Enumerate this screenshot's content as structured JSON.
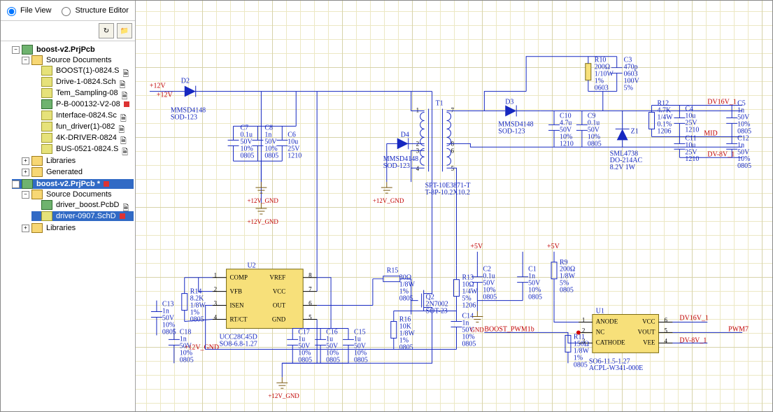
{
  "panel": {
    "view_file": "File View",
    "view_struct": "Structure Editor",
    "btn_refresh": "↻",
    "btn_locate": "📁"
  },
  "tree": {
    "p1": {
      "name": "boost-v2.PrjPcb",
      "src": "Source Documents",
      "f1": "BOOST(1)-0824.S",
      "f2": "Drive-1-0824.Sch",
      "f3": "Tem_Sampling-08",
      "f4": "P-B-000132-V2-08",
      "f5": "Interface-0824.Sc",
      "f6": "fun_driver(1)-082",
      "f7": "4K-DRIVER-0824",
      "f8": "BUS-0521-0824.S",
      "lib": "Libraries",
      "gen": "Generated"
    },
    "p2": {
      "name": "boost-v2.PrjPcb *",
      "src": "Source Documents",
      "f1": "driver_boost.PcbD",
      "f2": "driver-0907.SchD",
      "lib": "Libraries"
    }
  },
  "nets": {
    "p12v": "+12V",
    "p5v": "+5V",
    "gnd12": "+12V_GND",
    "gnd": "GND",
    "dv16": "DV16V_1",
    "dv8": "DV-8V_1",
    "mid": "MID",
    "pwm7": "PWM7",
    "boost_pwm": "BOOST_PWM1b"
  },
  "u2": {
    "ref": "U2",
    "part": "UCC28C45D",
    "pkg": "SO8-6.8-1.27",
    "p1": "COMP",
    "p2": "VFB",
    "p3": "ISEN",
    "p4": "RT/CT",
    "p5": "GND",
    "p6": "OUT",
    "p7": "VCC",
    "p8": "VREF",
    "n1": "1",
    "n2": "2",
    "n3": "3",
    "n4": "4",
    "n5": "5",
    "n6": "6",
    "n7": "7",
    "n8": "8"
  },
  "u1": {
    "ref": "U1",
    "part": "ACPL-W341-000E",
    "pkg": "SO6-11.5-1.27",
    "p1": "ANODE",
    "p2": "NC",
    "p3": "CATHODE",
    "p4": "VEE",
    "p5": "VOUT",
    "p6": "VCC",
    "n1": "1",
    "n2": "2",
    "n3": "3",
    "n4": "4",
    "n5": "5",
    "n6": "6"
  },
  "t1": {
    "ref": "T1",
    "part": "SPT-10E3871-T",
    "pkg": "T-8P-10.2X10.2",
    "p1": "1",
    "p2": "2",
    "p3": "3",
    "p4": "4",
    "p5": "5",
    "p6": "6",
    "p7": "7",
    "p8": "8"
  },
  "d2": {
    "ref": "D2",
    "part": "MMSD4148",
    "pkg": "SOD-123"
  },
  "d3": {
    "ref": "D3",
    "part": "MMSD4148",
    "pkg": "SOD-123"
  },
  "d4": {
    "ref": "D4",
    "part": "MMSD4148",
    "pkg": "SOD-123"
  },
  "z1": {
    "ref": "Z1",
    "part": "SML4738",
    "pkg": "DO-214AC",
    "val": "8.2V 1W"
  },
  "q2": {
    "ref": "Q2",
    "part": "2N7002",
    "pkg": "SOT-23"
  },
  "r9": {
    "ref": "R9",
    "val": "200Ω",
    "pwr": "1/8W",
    "tol": "5%",
    "pkg": "0805"
  },
  "r10": {
    "ref": "R10",
    "val": "200Ω",
    "pwr": "1/10W",
    "tol": "1%",
    "pkg": "0603"
  },
  "r11": {
    "ref": "R11",
    "val": "150Ω",
    "pwr": "1/8W",
    "tol": "1%",
    "pkg": "0805"
  },
  "r12": {
    "ref": "R12",
    "val": "4.7K",
    "pwr": "1/4W",
    "tol": "0.1%",
    "pkg": "1206"
  },
  "r13": {
    "ref": "R13",
    "val": "10Ω",
    "pwr": "1/4W",
    "tol": "5%",
    "pkg": "1206"
  },
  "r14": {
    "ref": "R14",
    "val": "8.2K",
    "pwr": "1/8W",
    "tol": "1%",
    "pkg": "0805"
  },
  "r15": {
    "ref": "R15",
    "val": "30Ω",
    "pwr": "1/8W",
    "tol": "1%",
    "pkg": "0805"
  },
  "r16": {
    "ref": "R16",
    "val": "10K",
    "pwr": "1/8W",
    "tol": "1%",
    "pkg": "0805"
  },
  "c1": {
    "ref": "C1",
    "val": "1n",
    "volt": "50V",
    "tol": "10%",
    "pkg": "0805"
  },
  "c2": {
    "ref": "C2",
    "val": "0.1u",
    "volt": "50V",
    "tol": "10%",
    "pkg": "0805"
  },
  "c3": {
    "ref": "C3",
    "val": "470p",
    "pkg": "0603",
    "volt": "100V",
    "tol": "5%"
  },
  "c4": {
    "ref": "C4",
    "val": "10u",
    "volt": "25V",
    "pkg": "1210"
  },
  "c5": {
    "ref": "C5",
    "val": "1n",
    "volt": "50V",
    "tol": "10%",
    "pkg": "0805"
  },
  "c6": {
    "ref": "C6",
    "val": "10u",
    "volt": "25V",
    "pkg": "1210"
  },
  "c7": {
    "ref": "C7",
    "val": "0.1u",
    "volt": "50V",
    "tol": "10%",
    "pkg": "0805"
  },
  "c8": {
    "ref": "C8",
    "val": "1n",
    "volt": "50V",
    "tol": "10%",
    "pkg": "0805"
  },
  "c9": {
    "ref": "C9",
    "val": "0.1u",
    "volt": "50V",
    "tol": "10%",
    "pkg": "0805"
  },
  "c10": {
    "ref": "C10",
    "val": "4.7u",
    "volt": "50V",
    "tol": "10%",
    "pkg": "1210"
  },
  "c11": {
    "ref": "C11",
    "val": "10u",
    "volt": "25V",
    "pkg": "1210"
  },
  "c12": {
    "ref": "C12",
    "val": "1n",
    "volt": "50V",
    "tol": "10%",
    "pkg": "0805"
  },
  "c13": {
    "ref": "C13",
    "val": "1n",
    "volt": "50V",
    "tol": "10%",
    "pkg": "0805"
  },
  "c14": {
    "ref": "C14",
    "val": "1n",
    "volt": "50V",
    "tol": "10%",
    "pkg": "0805"
  },
  "c15": {
    "ref": "C15",
    "val": "1u",
    "volt": "50V",
    "tol": "10%",
    "pkg": "0805"
  },
  "c16": {
    "ref": "C16",
    "val": "1u",
    "volt": "50V",
    "tol": "10%",
    "pkg": "0805"
  },
  "c17": {
    "ref": "C17",
    "val": "1u",
    "volt": "50V",
    "tol": "10%",
    "pkg": "0805"
  },
  "c18": {
    "ref": "C18",
    "val": "1n",
    "volt": "50V",
    "tol": "10%",
    "pkg": "0805"
  }
}
